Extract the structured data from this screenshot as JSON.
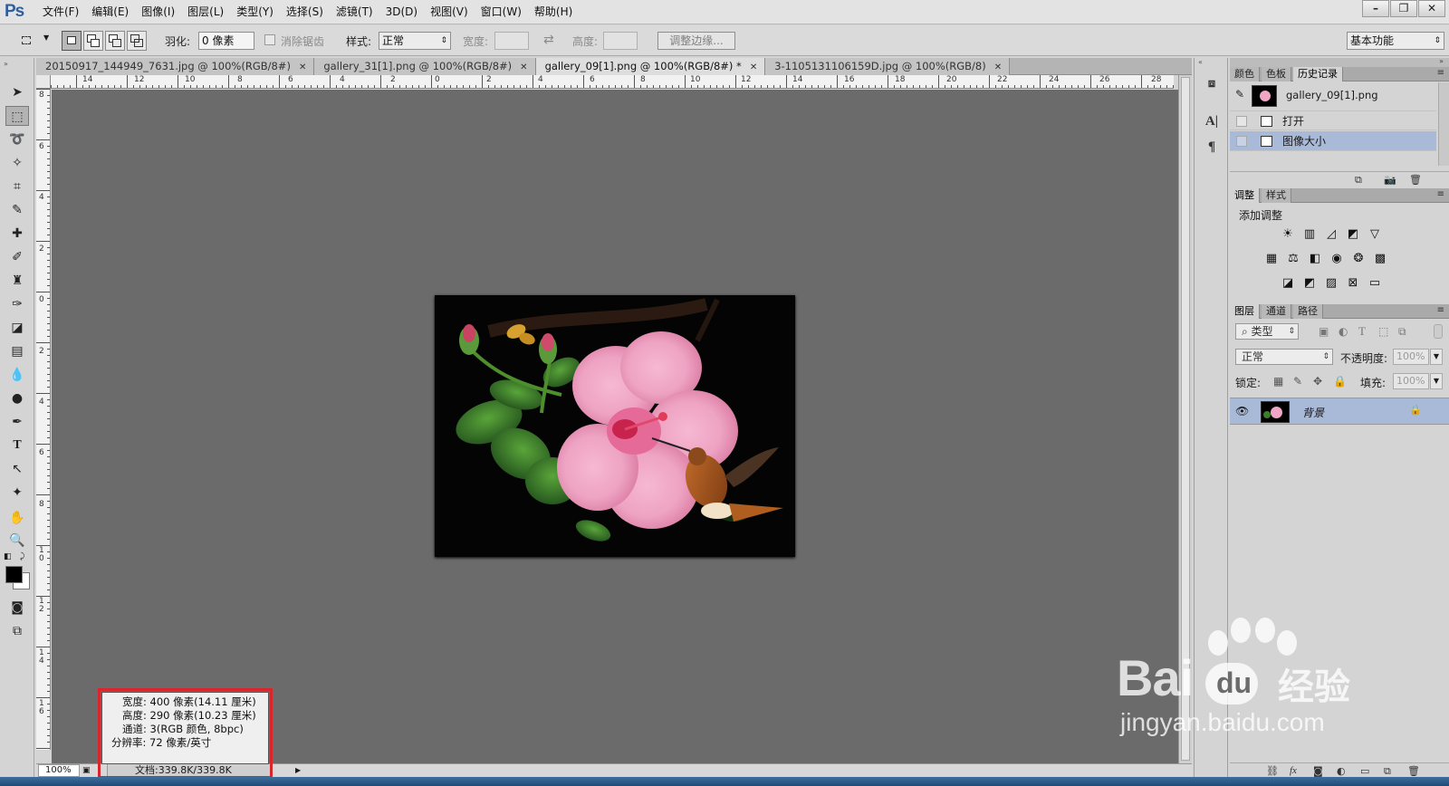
{
  "app": {
    "logo": "Ps",
    "menu": [
      "文件(F)",
      "编辑(E)",
      "图像(I)",
      "图层(L)",
      "类型(Y)",
      "选择(S)",
      "滤镜(T)",
      "3D(D)",
      "视图(V)",
      "窗口(W)",
      "帮助(H)"
    ]
  },
  "options": {
    "feather_label": "羽化:",
    "feather_value": "0 像素",
    "antialias_label": "消除锯齿",
    "style_label": "样式:",
    "style_value": "正常",
    "width_label": "宽度:",
    "height_label": "高度:",
    "refine_edge": "调整边缘...",
    "workspace": "基本功能"
  },
  "tabs": [
    {
      "label": "20150917_144949_7631.jpg @ 100%(RGB/8#)",
      "active": false
    },
    {
      "label": "gallery_31[1].png @ 100%(RGB/8#)",
      "active": false
    },
    {
      "label": "gallery_09[1].png @ 100%(RGB/8#) *",
      "active": true
    },
    {
      "label": "3-1105131106159D.jpg @ 100%(RGB/8)",
      "active": false
    }
  ],
  "rulers": {
    "horizontal": [
      "14",
      "12",
      "10",
      "8",
      "6",
      "4",
      "2",
      "0",
      "2",
      "4",
      "6",
      "8",
      "10",
      "12",
      "14",
      "16",
      "18",
      "20",
      "22",
      "24",
      "26",
      "28"
    ],
    "vertical": [
      "8",
      "6",
      "4",
      "2",
      "0",
      "2",
      "4",
      "6",
      "8",
      "10",
      "12",
      "14",
      "16"
    ]
  },
  "status": {
    "zoom": "100%",
    "doc": "文档:339.8K/339.8K"
  },
  "info_popup": {
    "width": "宽度: 400 像素(14.11 厘米)",
    "height": "高度: 290 像素(10.23 厘米)",
    "channels": "通道: 3(RGB 颜色, 8bpc)",
    "resolution": "分辨率: 72 像素/英寸"
  },
  "panels": {
    "history_tabs": [
      "颜色",
      "色板",
      "历史记录"
    ],
    "history_snapshot": "gallery_09[1].png",
    "history_items": [
      {
        "label": "打开",
        "selected": false
      },
      {
        "label": "图像大小",
        "selected": true
      }
    ],
    "adjust_tabs": [
      "调整",
      "样式"
    ],
    "adjust_title": "添加调整",
    "layers_tabs": [
      "图层",
      "通道",
      "路径"
    ],
    "layers_filter": "类型",
    "blend_mode": "正常",
    "opacity_label": "不透明度:",
    "opacity_value": "100%",
    "lock_label": "锁定:",
    "fill_label": "填充:",
    "fill_value": "100%",
    "layer_name": "背景"
  },
  "watermark": {
    "brand": "Bai",
    "brand_cn": "经验",
    "url": "jingyan.baidu.com"
  },
  "colors": {
    "canvas_bg": "#6b6b6b",
    "selection_blue": "#a9b9d8",
    "highlight_red": "#d9262c",
    "ps_blue": "#2f5f9e"
  }
}
